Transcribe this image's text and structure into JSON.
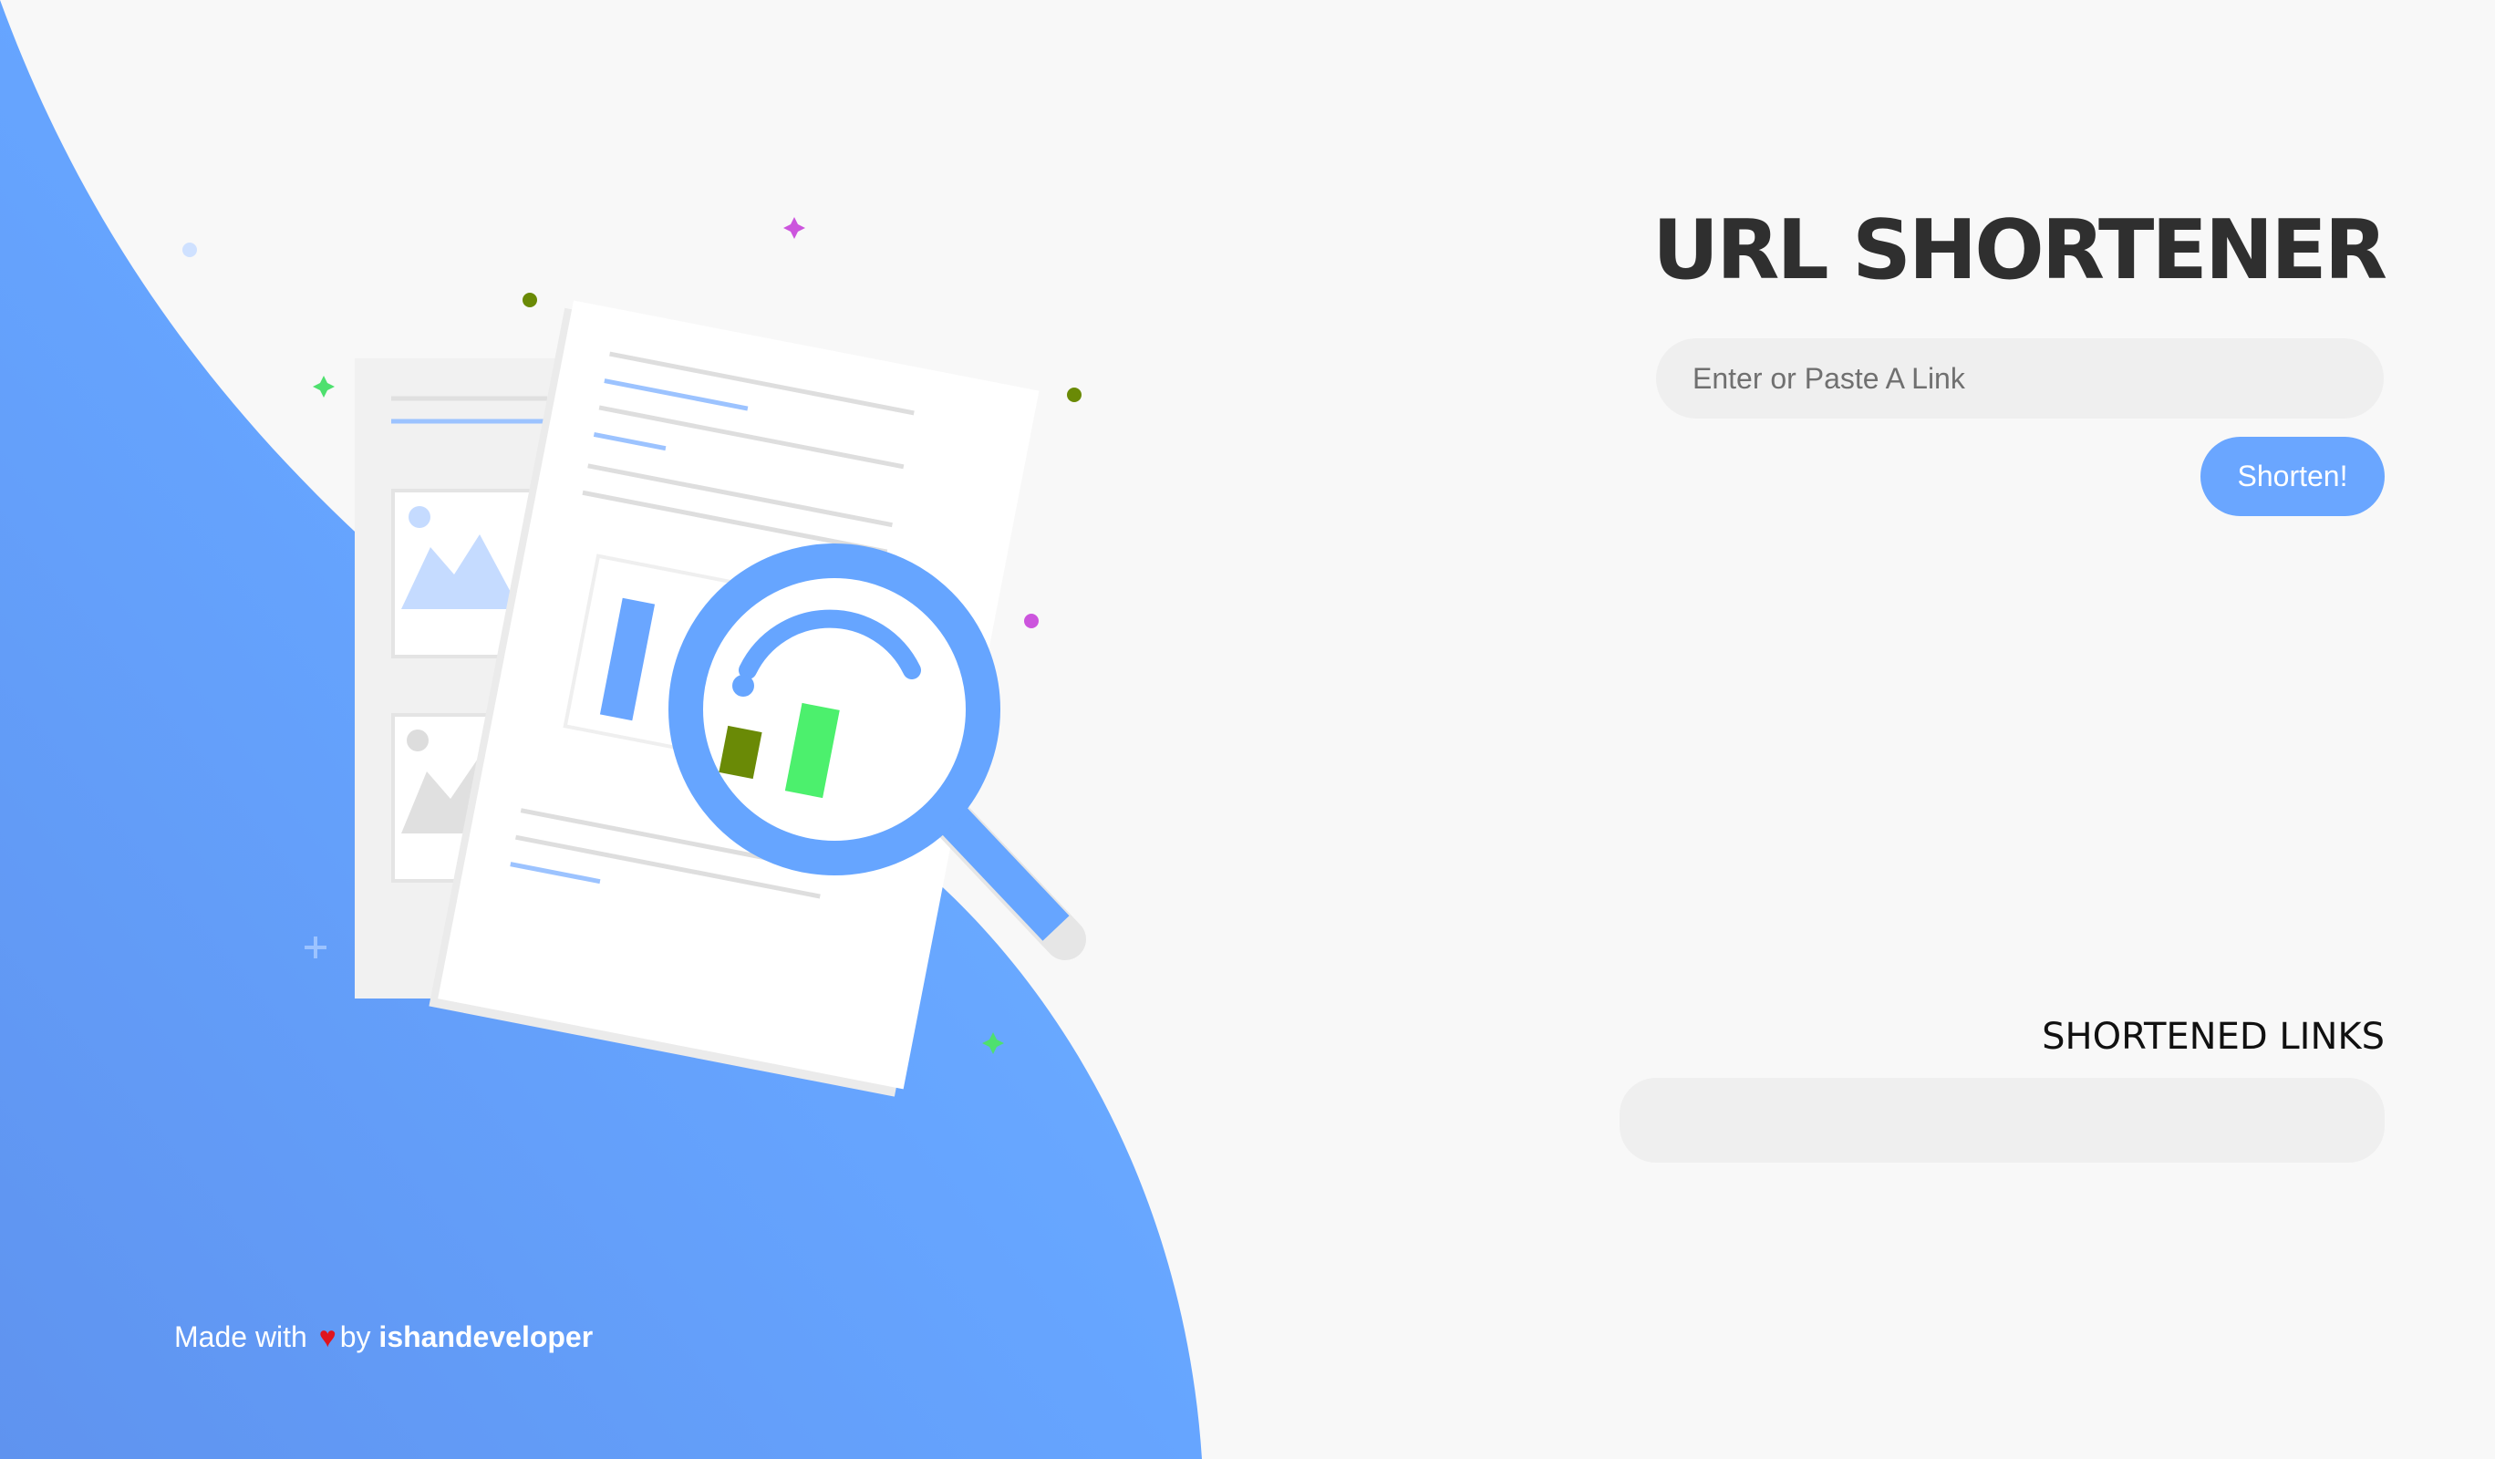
{
  "app": {
    "title": "URL SHORTENER"
  },
  "form": {
    "input_placeholder": "Enter or Paste A Link",
    "input_value": "",
    "shorten_label": "Shorten!"
  },
  "results": {
    "section_title": "SHORTENED LINKS",
    "items": []
  },
  "footer": {
    "prefix": "Made with",
    "heart": "♥",
    "by": "by",
    "author": "ishandeveloper"
  },
  "illustration": {
    "icon": "document-magnifier-icon"
  },
  "colors": {
    "accent": "#6aa6ff",
    "background": "#f8f8f8",
    "title": "#2f2f2f",
    "input_bg": "#efefef",
    "heart": "#e0141e"
  }
}
